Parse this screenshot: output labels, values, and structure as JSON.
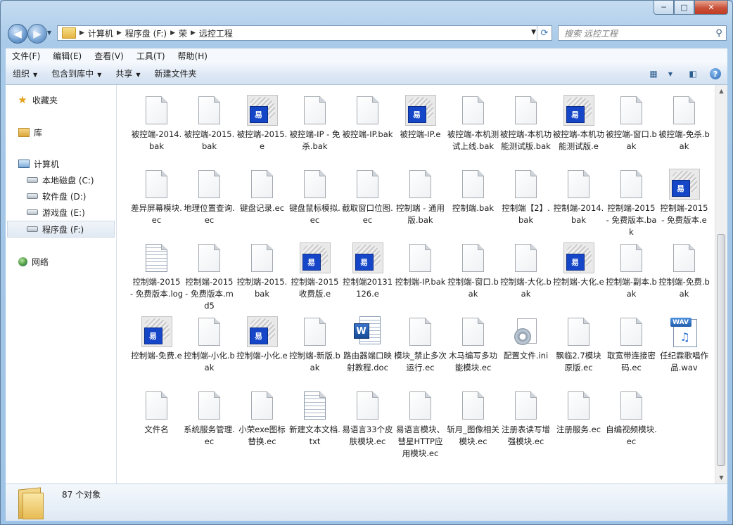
{
  "window": {
    "controls": {
      "minimize": "─",
      "maximize": "□",
      "close": "✕"
    }
  },
  "navigation": {
    "back_icon": "back-arrow-icon",
    "forward_icon": "forward-arrow-icon",
    "breadcrumb": [
      "计算机",
      "程序盘 (F:)",
      "荣",
      "远控工程"
    ],
    "search_placeholder": "搜索 远控工程"
  },
  "menu": [
    "文件(F)",
    "编辑(E)",
    "查看(V)",
    "工具(T)",
    "帮助(H)"
  ],
  "toolbar": {
    "organize": "组织",
    "include_library": "包含到库中",
    "share": "共享",
    "new_folder": "新建文件夹"
  },
  "sidebar": {
    "favorites": "收藏夹",
    "libraries": "库",
    "computer": "计算机",
    "drives": [
      "本地磁盘 (C:)",
      "软件盘 (D:)",
      "游戏盘 (E:)",
      "程序盘 (F:)"
    ],
    "network": "网络"
  },
  "files": [
    {
      "name": "被控端-2014.bak",
      "type": "doc"
    },
    {
      "name": "被控端-2015.bak",
      "type": "doc"
    },
    {
      "name": "被控端-2015.e",
      "type": "elang"
    },
    {
      "name": "被控端-IP - 免杀.bak",
      "type": "doc"
    },
    {
      "name": "被控端-IP.bak",
      "type": "doc"
    },
    {
      "name": "被控端-IP.e",
      "type": "elang"
    },
    {
      "name": "被控端-本机测试上线.bak",
      "type": "doc"
    },
    {
      "name": "被控端-本机功能测试版.bak",
      "type": "doc"
    },
    {
      "name": "被控端-本机功能测试版.e",
      "type": "elang"
    },
    {
      "name": "被控端-窗口.bak",
      "type": "doc"
    },
    {
      "name": "被控端-免杀.bak",
      "type": "doc"
    },
    {
      "name": "差异屏幕模块.ec",
      "type": "doc"
    },
    {
      "name": "地理位置查询.ec",
      "type": "doc"
    },
    {
      "name": "键盘记录.ec",
      "type": "doc"
    },
    {
      "name": "键盘鼠标模拟.ec",
      "type": "doc"
    },
    {
      "name": "截取窗口位图.ec",
      "type": "doc"
    },
    {
      "name": "控制端 - 通用版.bak",
      "type": "doc"
    },
    {
      "name": "控制端.bak",
      "type": "doc"
    },
    {
      "name": "控制端【2】.bak",
      "type": "doc"
    },
    {
      "name": "控制端-2014.bak",
      "type": "doc"
    },
    {
      "name": "控制端-2015 - 免费版本.bak",
      "type": "doc"
    },
    {
      "name": "控制端-2015 - 免费版本.e",
      "type": "elang"
    },
    {
      "name": "控制端-2015 - 免费版本.log",
      "type": "lines"
    },
    {
      "name": "控制端-2015 - 免费版本.md5",
      "type": "doc"
    },
    {
      "name": "控制端-2015.bak",
      "type": "doc"
    },
    {
      "name": "控制端-2015收费版.e",
      "type": "elang"
    },
    {
      "name": "控制端20131126.e",
      "type": "elang"
    },
    {
      "name": "控制端-IP.bak",
      "type": "doc"
    },
    {
      "name": "控制端-窗口.bak",
      "type": "doc"
    },
    {
      "name": "控制端-大化.bak",
      "type": "doc"
    },
    {
      "name": "控制端-大化.e",
      "type": "elang"
    },
    {
      "name": "控制端-副本.bak",
      "type": "doc"
    },
    {
      "name": "控制端-免费.bak",
      "type": "doc"
    },
    {
      "name": "控制端-免费.e",
      "type": "elang"
    },
    {
      "name": "控制端-小化.bak",
      "type": "doc"
    },
    {
      "name": "控制端-小化.e",
      "type": "elang"
    },
    {
      "name": "控制端-新版.bak",
      "type": "doc"
    },
    {
      "name": "路由器端口映射教程.doc",
      "type": "word"
    },
    {
      "name": "模块_禁止多次运行.ec",
      "type": "doc"
    },
    {
      "name": "木马编写多功能模块.ec",
      "type": "doc"
    },
    {
      "name": "配置文件.ini",
      "type": "ini"
    },
    {
      "name": "飘临2.7模块原版.ec",
      "type": "doc"
    },
    {
      "name": "取宽带连接密码.ec",
      "type": "doc"
    },
    {
      "name": "任纪霖歌唱作品.wav",
      "type": "wav"
    },
    {
      "name": "文件名",
      "type": "doc"
    },
    {
      "name": "系统服务管理.ec",
      "type": "doc"
    },
    {
      "name": "小荣exe图标替换.ec",
      "type": "doc"
    },
    {
      "name": "新建文本文档.txt",
      "type": "lines"
    },
    {
      "name": "易语言33个皮肤模块.ec",
      "type": "doc"
    },
    {
      "name": "易语言模块、彗星HTTP应用模块.ec",
      "type": "doc"
    },
    {
      "name": "斩月_图像相关模块.ec",
      "type": "doc"
    },
    {
      "name": "注册表读写增强模块.ec",
      "type": "doc"
    },
    {
      "name": "注册服务.ec",
      "type": "doc"
    },
    {
      "name": "自编视频模块.ec",
      "type": "doc"
    }
  ],
  "status": {
    "count_text": "87 个对象"
  },
  "colors": {
    "accent": "#9ec3e6",
    "elang_blue": "#1646c8",
    "close_red": "#c23a22"
  }
}
